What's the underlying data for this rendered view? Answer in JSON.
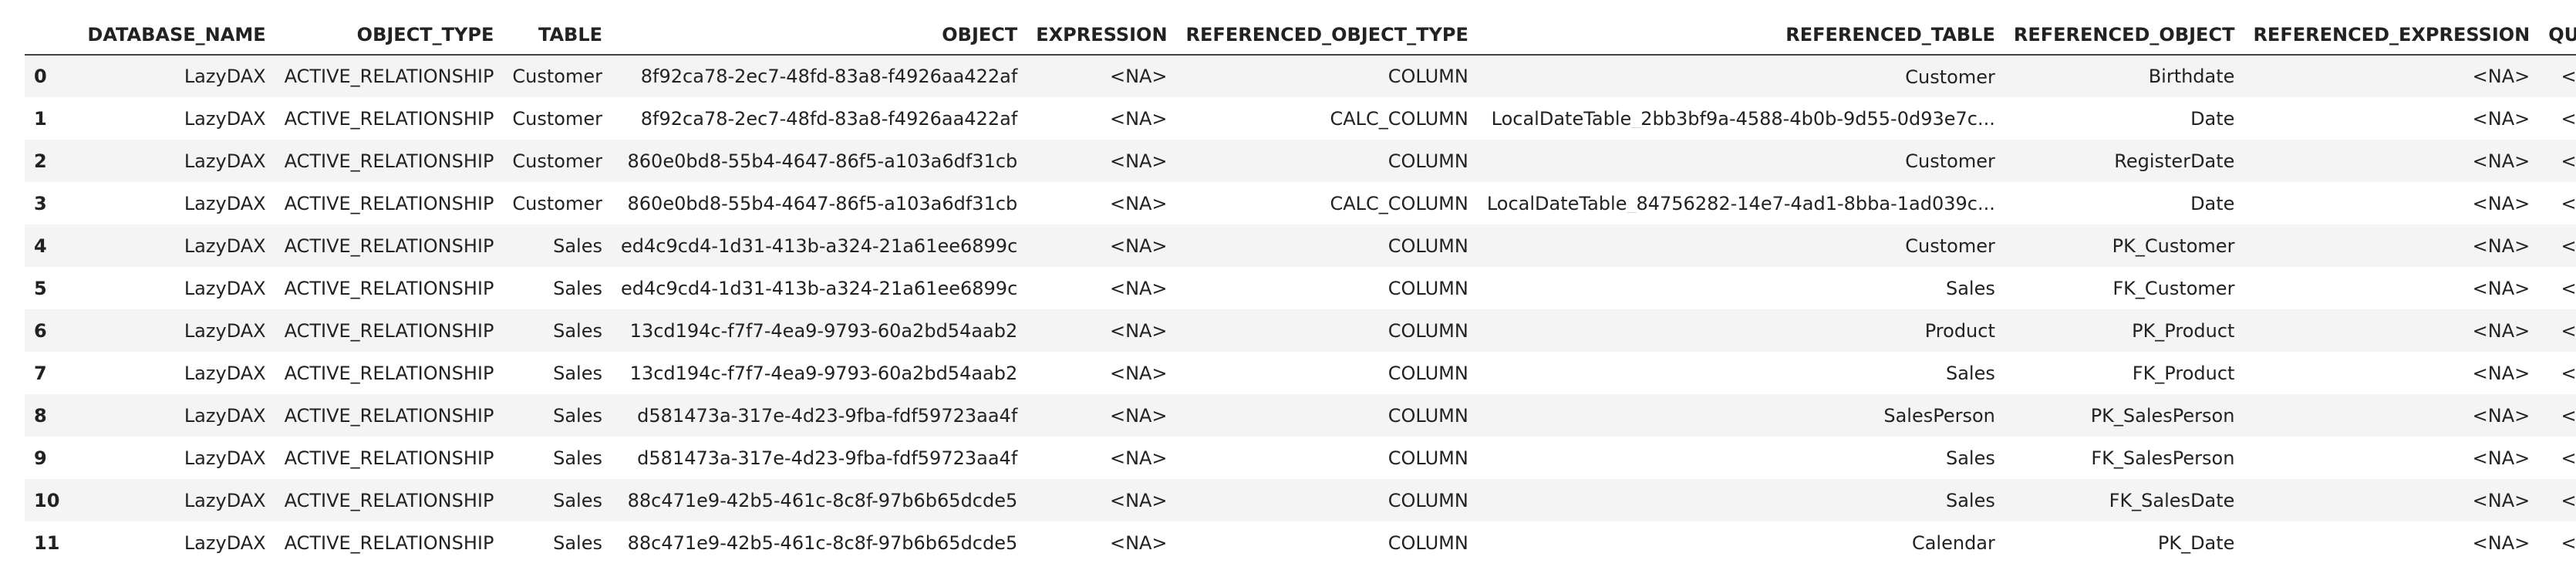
{
  "table": {
    "columns": [
      "DATABASE_NAME",
      "OBJECT_TYPE",
      "TABLE",
      "OBJECT",
      "EXPRESSION",
      "REFERENCED_OBJECT_TYPE",
      "REFERENCED_TABLE",
      "REFERENCED_OBJECT",
      "REFERENCED_EXPRESSION",
      "QUERY"
    ],
    "rows": [
      {
        "index": "0",
        "cells": [
          "LazyDAX",
          "ACTIVE_RELATIONSHIP",
          "Customer",
          "8f92ca78-2ec7-48fd-83a8-f4926aa422af",
          "<NA>",
          "COLUMN",
          "Customer",
          "Birthdate",
          "<NA>",
          "<NA>"
        ]
      },
      {
        "index": "1",
        "cells": [
          "LazyDAX",
          "ACTIVE_RELATIONSHIP",
          "Customer",
          "8f92ca78-2ec7-48fd-83a8-f4926aa422af",
          "<NA>",
          "CALC_COLUMN",
          "LocalDateTable_2bb3bf9a-4588-4b0b-9d55-0d93e7c...",
          "Date",
          "<NA>",
          "<NA>"
        ]
      },
      {
        "index": "2",
        "cells": [
          "LazyDAX",
          "ACTIVE_RELATIONSHIP",
          "Customer",
          "860e0bd8-55b4-4647-86f5-a103a6df31cb",
          "<NA>",
          "COLUMN",
          "Customer",
          "RegisterDate",
          "<NA>",
          "<NA>"
        ]
      },
      {
        "index": "3",
        "cells": [
          "LazyDAX",
          "ACTIVE_RELATIONSHIP",
          "Customer",
          "860e0bd8-55b4-4647-86f5-a103a6df31cb",
          "<NA>",
          "CALC_COLUMN",
          "LocalDateTable_84756282-14e7-4ad1-8bba-1ad039c...",
          "Date",
          "<NA>",
          "<NA>"
        ]
      },
      {
        "index": "4",
        "cells": [
          "LazyDAX",
          "ACTIVE_RELATIONSHIP",
          "Sales",
          "ed4c9cd4-1d31-413b-a324-21a61ee6899c",
          "<NA>",
          "COLUMN",
          "Customer",
          "PK_Customer",
          "<NA>",
          "<NA>"
        ]
      },
      {
        "index": "5",
        "cells": [
          "LazyDAX",
          "ACTIVE_RELATIONSHIP",
          "Sales",
          "ed4c9cd4-1d31-413b-a324-21a61ee6899c",
          "<NA>",
          "COLUMN",
          "Sales",
          "FK_Customer",
          "<NA>",
          "<NA>"
        ]
      },
      {
        "index": "6",
        "cells": [
          "LazyDAX",
          "ACTIVE_RELATIONSHIP",
          "Sales",
          "13cd194c-f7f7-4ea9-9793-60a2bd54aab2",
          "<NA>",
          "COLUMN",
          "Product",
          "PK_Product",
          "<NA>",
          "<NA>"
        ]
      },
      {
        "index": "7",
        "cells": [
          "LazyDAX",
          "ACTIVE_RELATIONSHIP",
          "Sales",
          "13cd194c-f7f7-4ea9-9793-60a2bd54aab2",
          "<NA>",
          "COLUMN",
          "Sales",
          "FK_Product",
          "<NA>",
          "<NA>"
        ]
      },
      {
        "index": "8",
        "cells": [
          "LazyDAX",
          "ACTIVE_RELATIONSHIP",
          "Sales",
          "d581473a-317e-4d23-9fba-fdf59723aa4f",
          "<NA>",
          "COLUMN",
          "SalesPerson",
          "PK_SalesPerson",
          "<NA>",
          "<NA>"
        ]
      },
      {
        "index": "9",
        "cells": [
          "LazyDAX",
          "ACTIVE_RELATIONSHIP",
          "Sales",
          "d581473a-317e-4d23-9fba-fdf59723aa4f",
          "<NA>",
          "COLUMN",
          "Sales",
          "FK_SalesPerson",
          "<NA>",
          "<NA>"
        ]
      },
      {
        "index": "10",
        "cells": [
          "LazyDAX",
          "ACTIVE_RELATIONSHIP",
          "Sales",
          "88c471e9-42b5-461c-8c8f-97b6b65dcde5",
          "<NA>",
          "COLUMN",
          "Sales",
          "FK_SalesDate",
          "<NA>",
          "<NA>"
        ]
      },
      {
        "index": "11",
        "cells": [
          "LazyDAX",
          "ACTIVE_RELATIONSHIP",
          "Sales",
          "88c471e9-42b5-461c-8c8f-97b6b65dcde5",
          "<NA>",
          "COLUMN",
          "Calendar",
          "PK_Date",
          "<NA>",
          "<NA>"
        ]
      }
    ]
  }
}
